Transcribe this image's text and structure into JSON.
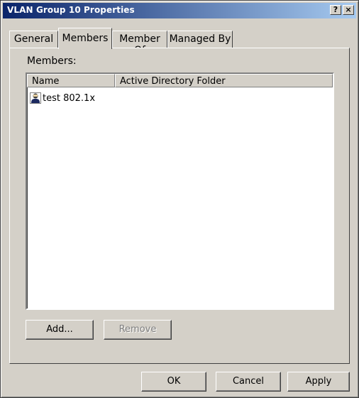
{
  "window": {
    "title": "VLAN Group 10 Properties",
    "help_glyph": "?",
    "close_glyph": "×"
  },
  "tabs": [
    {
      "label": "General",
      "active": false
    },
    {
      "label": "Members",
      "active": true
    },
    {
      "label": "Member Of",
      "active": false
    },
    {
      "label": "Managed By",
      "active": false
    }
  ],
  "members": {
    "label": "Members:",
    "columns": [
      "Name",
      "Active Directory Folder"
    ],
    "rows": [
      {
        "name": "test 802.1x",
        "folder": "",
        "icon": "user-icon"
      }
    ],
    "add_label": "Add...",
    "remove_label": "Remove"
  },
  "footer": {
    "ok_label": "OK",
    "cancel_label": "Cancel",
    "apply_label": "Apply"
  },
  "colors": {
    "face": "#d4d0c8",
    "title_start": "#0a246a",
    "title_end": "#a6caf0",
    "disabled_text": "#808080"
  }
}
